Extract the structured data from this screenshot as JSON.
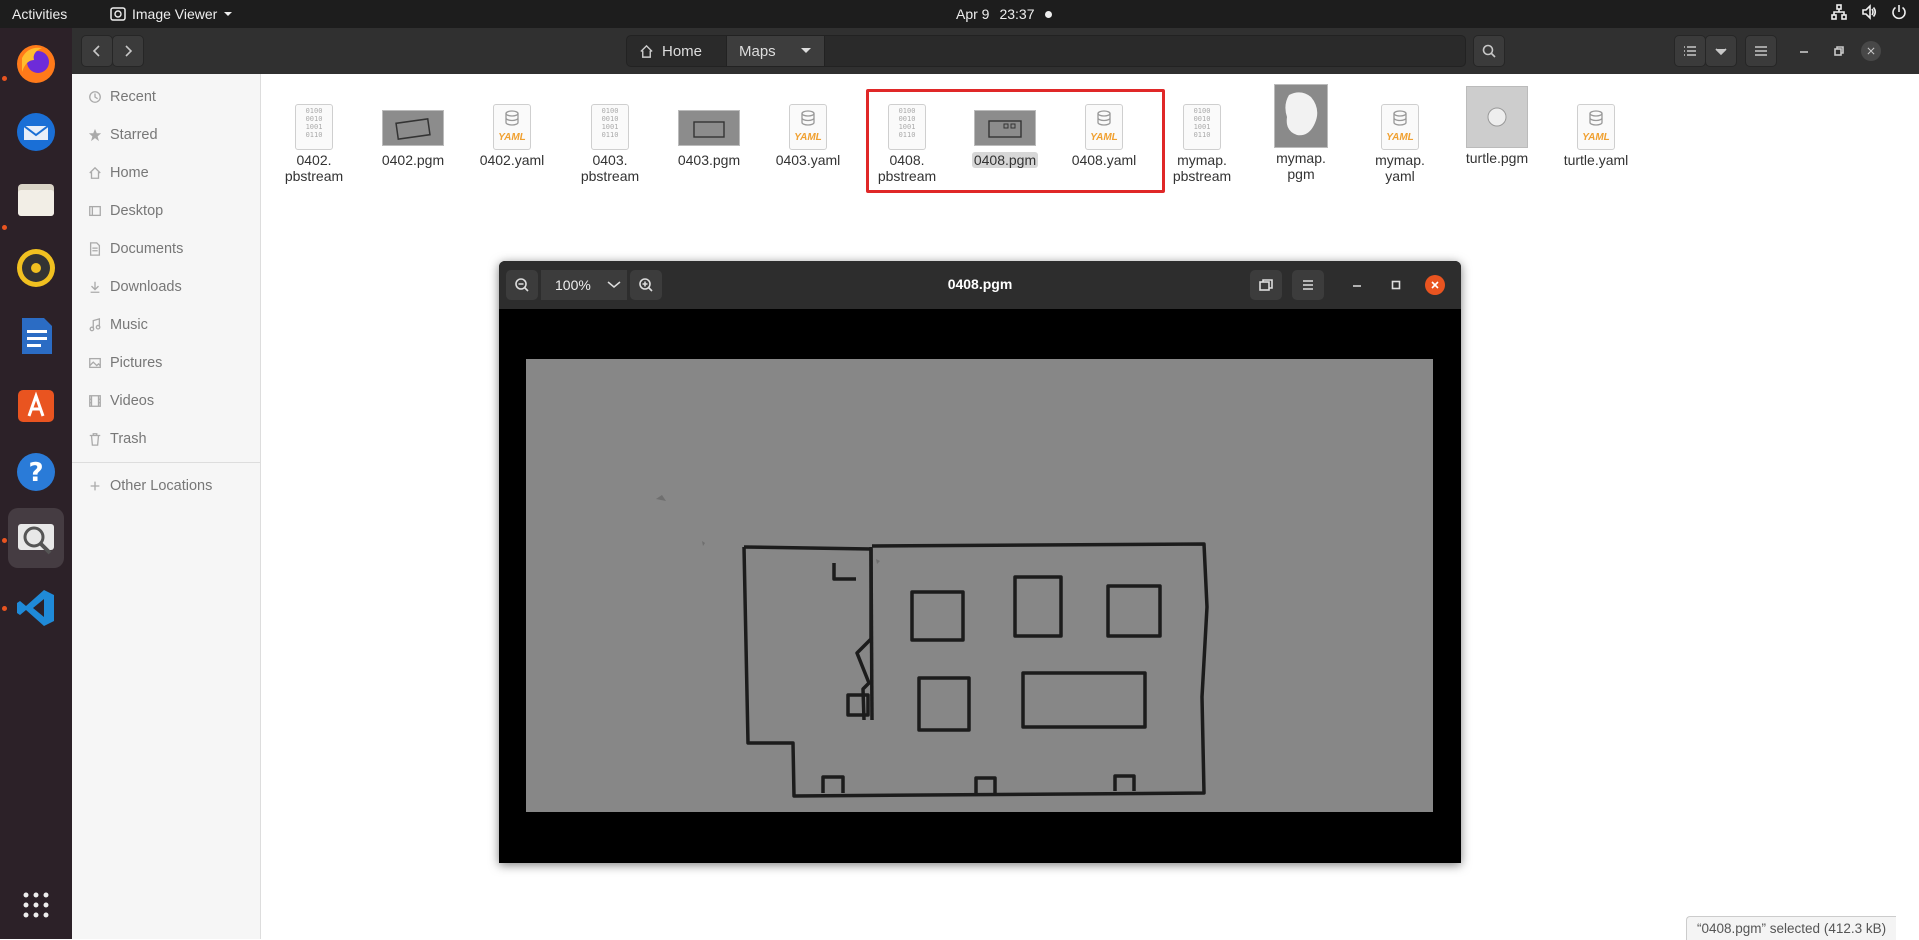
{
  "topbar": {
    "activities": "Activities",
    "app_name": "Image Viewer",
    "date": "Apr 9",
    "time": "23:37"
  },
  "dock": {
    "items": [
      "firefox-icon",
      "thunderbird-icon",
      "files-icon",
      "rhythmbox-icon",
      "writer-icon",
      "app-center-icon",
      "help-icon",
      "image-viewer-icon",
      "vscode-icon"
    ]
  },
  "files": {
    "path": {
      "home": "Home",
      "current": "Maps"
    },
    "sidebar": {
      "items": [
        {
          "label": "Recent",
          "icon": "clock-icon"
        },
        {
          "label": "Starred",
          "icon": "star-icon"
        },
        {
          "label": "Home",
          "icon": "home-icon"
        },
        {
          "label": "Desktop",
          "icon": "desktop-icon"
        },
        {
          "label": "Documents",
          "icon": "documents-icon"
        },
        {
          "label": "Downloads",
          "icon": "download-icon"
        },
        {
          "label": "Music",
          "icon": "music-icon"
        },
        {
          "label": "Pictures",
          "icon": "pictures-icon"
        },
        {
          "label": "Videos",
          "icon": "videos-icon"
        },
        {
          "label": "Trash",
          "icon": "trash-icon"
        }
      ],
      "other_locations": "Other Locations"
    },
    "items": [
      {
        "line1": "0402.",
        "line2": "pbstream",
        "type": "binary"
      },
      {
        "line1": "0402.pgm",
        "line2": "",
        "type": "map-thumb"
      },
      {
        "line1": "0402.yaml",
        "line2": "",
        "type": "yaml"
      },
      {
        "line1": "0403.",
        "line2": "pbstream",
        "type": "binary"
      },
      {
        "line1": "0403.pgm",
        "line2": "",
        "type": "map-thumb"
      },
      {
        "line1": "0403.yaml",
        "line2": "",
        "type": "yaml"
      },
      {
        "line1": "0408.",
        "line2": "pbstream",
        "type": "binary"
      },
      {
        "line1": "0408.pgm",
        "line2": "",
        "type": "map-thumb"
      },
      {
        "line1": "0408.yaml",
        "line2": "",
        "type": "yaml"
      },
      {
        "line1": "mymap.",
        "line2": "pbstream",
        "type": "binary"
      },
      {
        "line1": "mymap.",
        "line2": "pgm",
        "type": "blob-thumb"
      },
      {
        "line1": "mymap.",
        "line2": "yaml",
        "type": "yaml"
      },
      {
        "line1": "turtle.pgm",
        "line2": "",
        "type": "turtle-thumb"
      },
      {
        "line1": "turtle.yaml",
        "line2": "",
        "type": "yaml"
      }
    ],
    "binary_glyph": "0100\n0010\n1001\n0110",
    "yaml_badge": "YAML",
    "status": "“0408.pgm” selected  (412.3 kB)"
  },
  "viewer": {
    "zoom": "100%",
    "title": "0408.pgm"
  },
  "colors": {
    "accent": "#e95420",
    "highlight": "#e02828",
    "map_bg": "#878787"
  }
}
